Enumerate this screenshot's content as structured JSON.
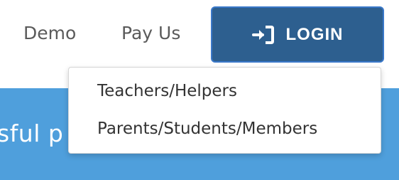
{
  "nav": {
    "demo_label": "Demo",
    "payus_label": "Pay Us",
    "login_label": "LOGIN",
    "login_icon": "sign-in-icon"
  },
  "login_menu": {
    "items": [
      {
        "label": "Teachers/Helpers"
      },
      {
        "label": "Parents/Students/Members"
      }
    ]
  },
  "hero": {
    "text_fragment": "sful p"
  },
  "colors": {
    "login_button": "#2d5f8f",
    "hero_background": "#4f9fdc",
    "nav_text": "#5a5a5a"
  }
}
